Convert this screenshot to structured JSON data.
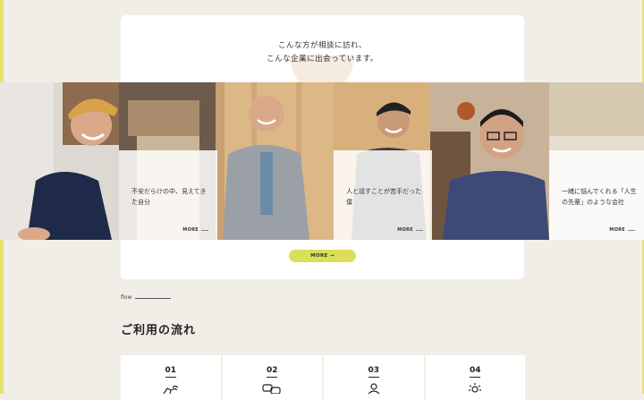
{
  "intro": {
    "line1": "こんな方が相談に訪れ、",
    "line2": "こんな企業に出会っています。"
  },
  "cards": [
    {
      "text": "不安だらけの中、見えてきた自分",
      "more": "MORE"
    },
    {
      "text": "人と話すことが苦手だった僕",
      "more": "MORE"
    },
    {
      "text": "一緒に悩んでくれる「人生の先輩」のような会社",
      "more": "MORE"
    }
  ],
  "more_button": "MORE →",
  "flow": {
    "label": "flow",
    "title": "ご利用の流れ"
  },
  "steps": [
    {
      "num": "01",
      "icon": "wifi-hand-icon"
    },
    {
      "num": "02",
      "icon": "chat-icon"
    },
    {
      "num": "03",
      "icon": "handshake-icon"
    },
    {
      "num": "04",
      "icon": "sparkle-icon"
    }
  ],
  "colors": {
    "accent": "#dcde5a",
    "background": "#f1eee8"
  }
}
